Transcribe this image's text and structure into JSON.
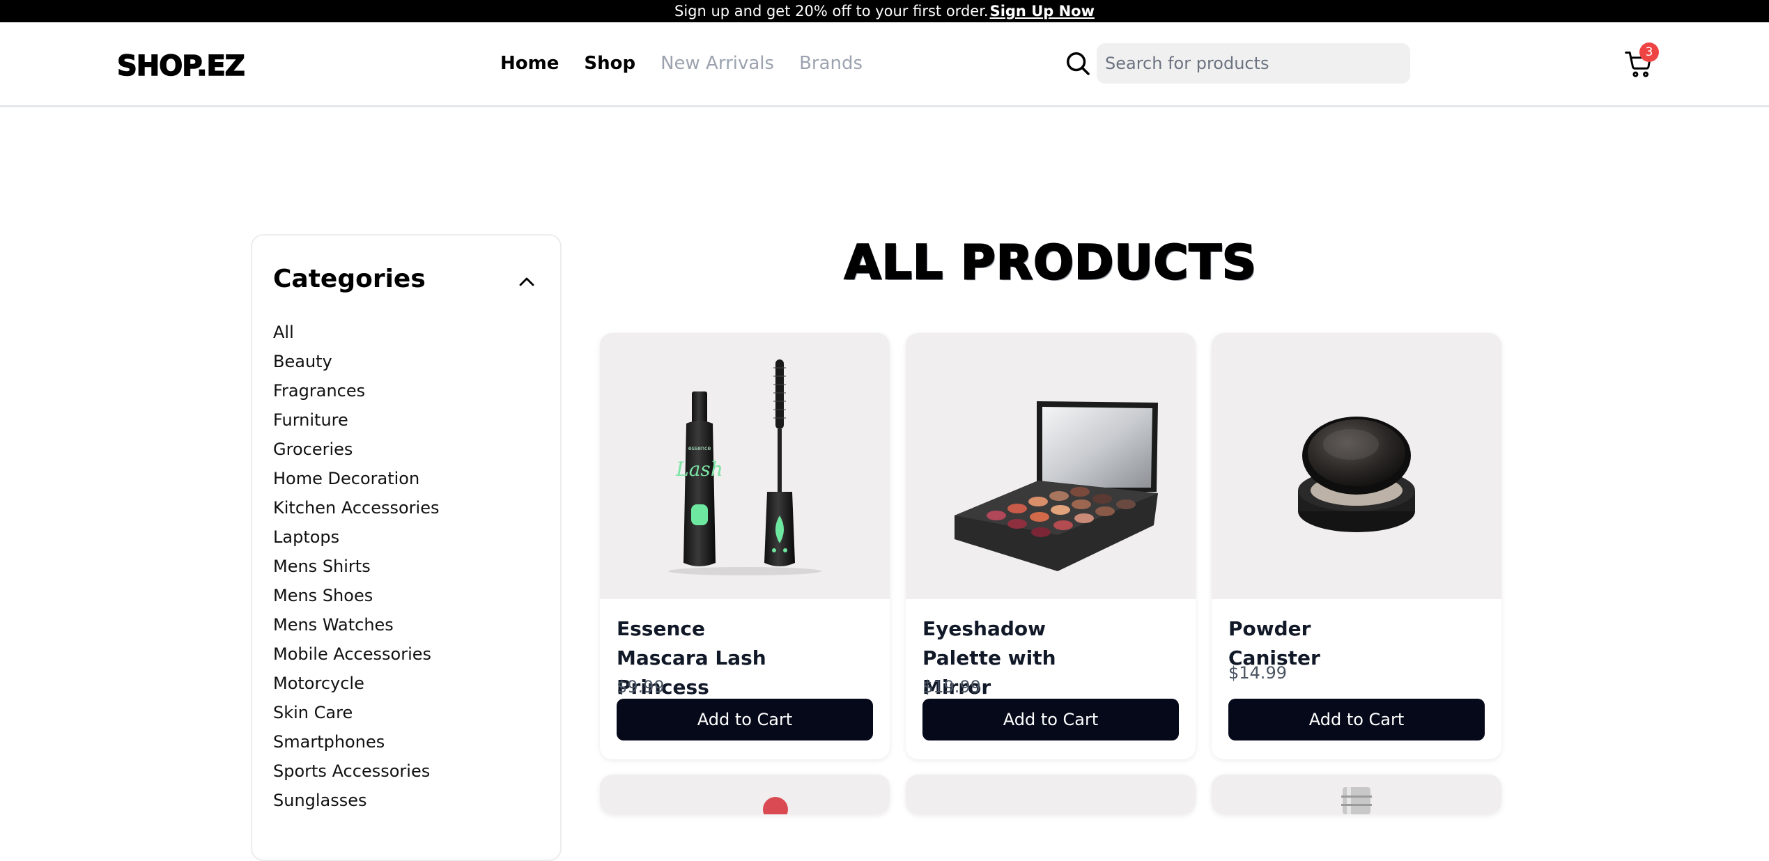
{
  "promo": {
    "text": "Sign up and get 20% off to your first order.",
    "link": "Sign Up Now"
  },
  "header": {
    "logo": "SHOP.EZ",
    "nav": [
      "Home",
      "Shop",
      "New Arrivals",
      "Brands"
    ],
    "search_placeholder": "Search for products",
    "cart_count": "3"
  },
  "sidebar": {
    "title": "Categories",
    "categories": [
      "All",
      "Beauty",
      "Fragrances",
      "Furniture",
      "Groceries",
      "Home Decoration",
      "Kitchen Accessories",
      "Laptops",
      "Mens Shirts",
      "Mens Shoes",
      "Mens Watches",
      "Mobile Accessories",
      "Motorcycle",
      "Skin Care",
      "Smartphones",
      "Sports Accessories",
      "Sunglasses"
    ]
  },
  "main": {
    "heading": "ALL PRODUCTS",
    "products": [
      {
        "name": "Essence Mascara Lash Princess",
        "price": "$9.99",
        "button": "Add to Cart",
        "image_icon": "mascara-image"
      },
      {
        "name": "Eyeshadow Palette with Mirror",
        "price": "$19.99",
        "button": "Add to Cart",
        "image_icon": "eyeshadow-palette-image"
      },
      {
        "name": "Powder Canister",
        "price": "$14.99",
        "button": "Add to Cart",
        "image_icon": "powder-canister-image"
      }
    ]
  },
  "colors": {
    "accent": "#05091a",
    "badge": "#ef4444",
    "card_image_bg": "#f0eeef"
  }
}
